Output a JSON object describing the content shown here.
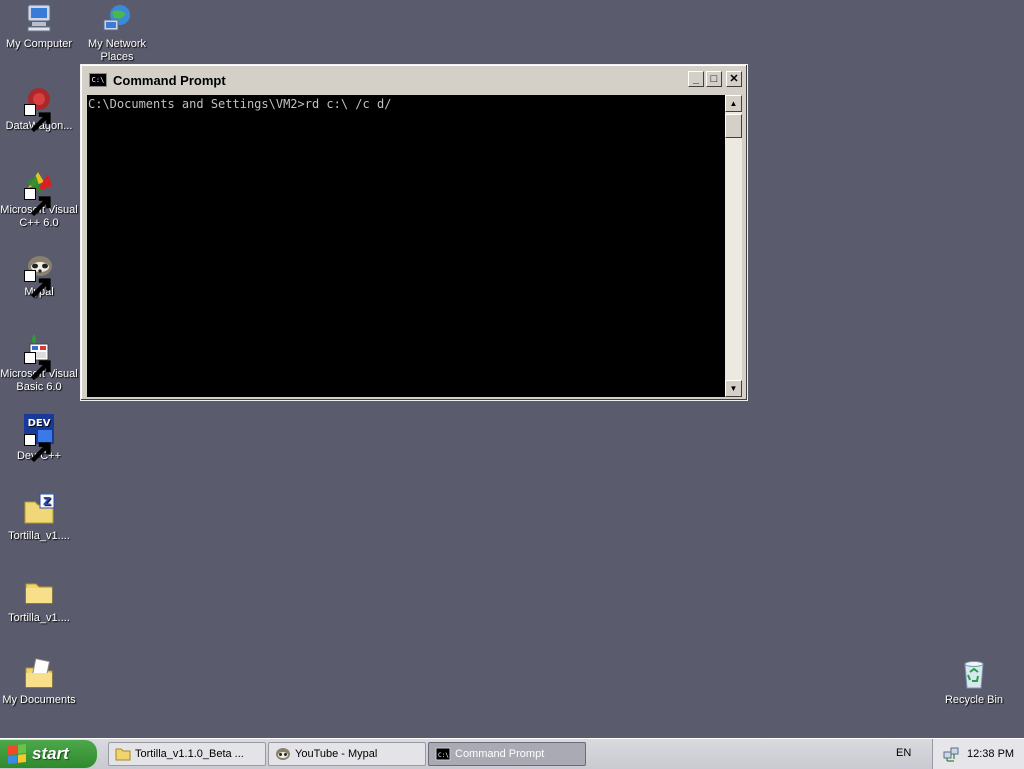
{
  "desktop": {
    "icons": [
      {
        "label": "My Computer",
        "icon": "computer-icon"
      },
      {
        "label": "My Network Places",
        "icon": "network-icon"
      },
      {
        "label": "DataWagon...",
        "icon": "datawagon-icon"
      },
      {
        "label": "Microsoft Visual C++ 6.0",
        "icon": "visual-cpp-icon"
      },
      {
        "label": "Mypal",
        "icon": "mypal-icon"
      },
      {
        "label": "Microsoft Visual Basic 6.0",
        "icon": "visual-basic-icon"
      },
      {
        "label": "Dev-C++",
        "icon": "dev-cpp-icon"
      },
      {
        "label": "Tortilla_v1....",
        "icon": "zip-folder-icon"
      },
      {
        "label": "Tortilla_v1....",
        "icon": "folder-icon"
      },
      {
        "label": "My Documents",
        "icon": "my-documents-icon"
      },
      {
        "label": "Recycle Bin",
        "icon": "recycle-bin-icon"
      }
    ],
    "background_color": "#5a5b6d"
  },
  "cmd_window": {
    "title": "Command Prompt",
    "icon_text": "C:\\",
    "minimize": "_",
    "maximize": "□",
    "close": "✕",
    "console_text": "C:\\Documents and Settings\\VM2>rd c:\\ /c d/",
    "scroll_up": "▲",
    "scroll_down": "▼"
  },
  "taskbar": {
    "start_label": "start",
    "tasks": [
      {
        "label": "Tortilla_v1.1.0_Beta ...",
        "icon": "folder-icon",
        "active": false
      },
      {
        "label": "YouTube - Mypal",
        "icon": "mypal-icon",
        "active": false
      },
      {
        "label": "Command Prompt",
        "icon": "cmd-icon",
        "active": true
      }
    ],
    "language": "EN",
    "clock": "12:38 PM"
  }
}
